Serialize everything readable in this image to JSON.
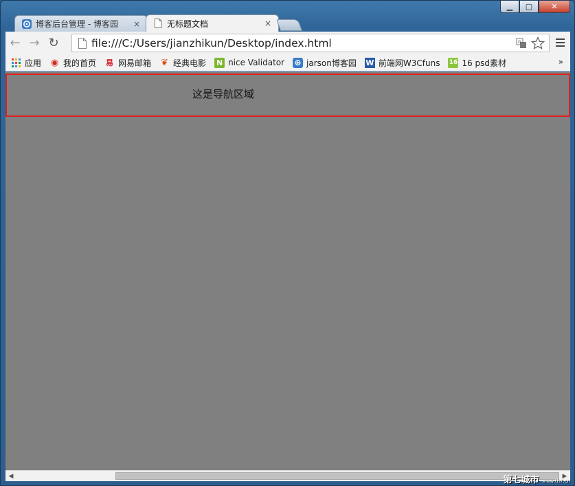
{
  "window": {
    "controls": {
      "minimize": "▁",
      "maximize": "▢",
      "close": "✕"
    }
  },
  "tabs": [
    {
      "title": "博客后台管理 - 博客园",
      "close": "×",
      "icon": "cnblogs-icon",
      "active": false
    },
    {
      "title": "无标题文档",
      "close": "×",
      "icon": "page-icon",
      "active": true
    }
  ],
  "toolbar": {
    "back": "←",
    "forward": "→",
    "reload": "↻",
    "url": "file:///C:/Users/jianzhikun/Desktop/index.html"
  },
  "bookmarks": {
    "items": [
      {
        "label": "应用",
        "icon": "apps-grid-icon",
        "glyph": ""
      },
      {
        "label": "我的首页",
        "icon": "weibo-icon",
        "glyph": "◉"
      },
      {
        "label": "网易邮箱",
        "icon": "netease-mail-icon",
        "glyph": "易"
      },
      {
        "label": "经典电影",
        "icon": "leaf-icon",
        "glyph": "❦"
      },
      {
        "label": "nice Validator",
        "icon": "n-logo-icon",
        "glyph": "N"
      },
      {
        "label": "jarson博客园",
        "icon": "cnblogs-icon",
        "glyph": "⊛"
      },
      {
        "label": "前端网W3Cfuns",
        "icon": "w-logo-icon",
        "glyph": "W"
      },
      {
        "label": "16 psd素材",
        "icon": "16-logo-icon",
        "glyph": "16"
      }
    ],
    "more": "»"
  },
  "page": {
    "nav_text": "这是导航区域"
  },
  "scrollbar": {
    "left": "◀",
    "right": "▶"
  },
  "watermark": {
    "text": "第七城市",
    "sub": "www.th7.cn"
  },
  "colors": {
    "content_bg": "#808080",
    "nav_border": "#e01e1e"
  }
}
